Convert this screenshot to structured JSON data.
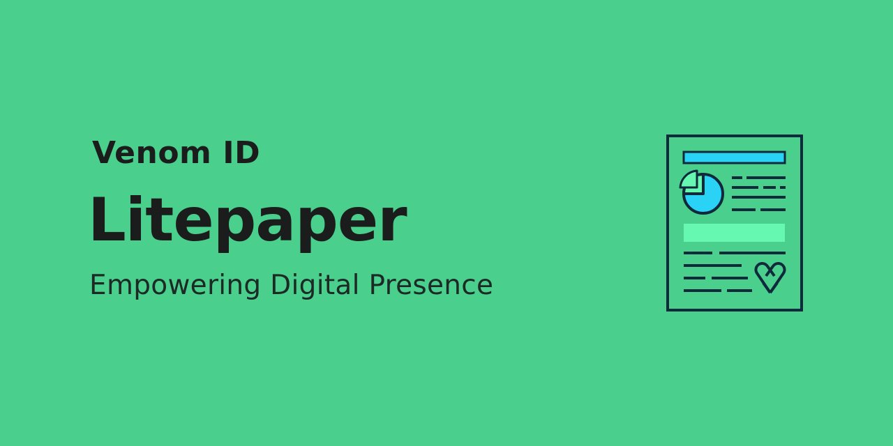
{
  "header": {
    "brand": "Venom ID",
    "title": "Litepaper",
    "subtitle": "Empowering Digital Presence"
  },
  "illustration": {
    "icon": "document-report-icon",
    "logo_icon": "venom-logo-icon"
  },
  "colors": {
    "background": "#4bcf8d",
    "text": "#1a1d1c",
    "outline": "#0f2a3a",
    "cyan": "#2ad3f5",
    "mint": "#66f7b1"
  }
}
